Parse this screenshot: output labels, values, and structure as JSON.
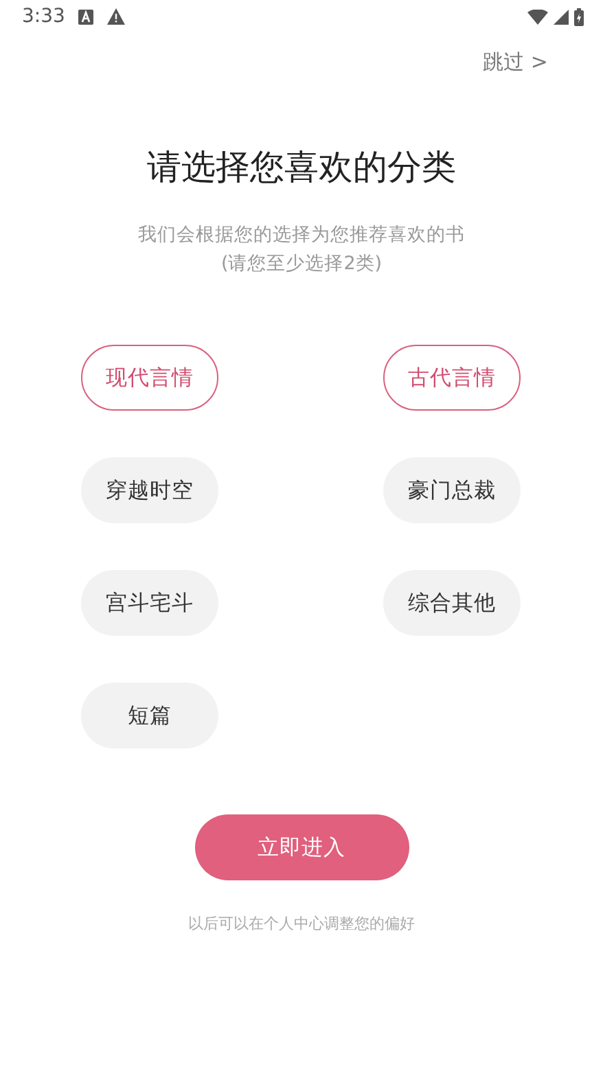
{
  "status_bar": {
    "time": "3:33"
  },
  "skip": "跳过 >",
  "title": "请选择您喜欢的分类",
  "subtitle": [
    "我们会根据您的选择为您推荐喜欢的书",
    "(请您至少选择2类)"
  ],
  "categories": [
    {
      "label": "现代言情",
      "selected": true
    },
    {
      "label": "古代言情",
      "selected": true
    },
    {
      "label": "穿越时空",
      "selected": false
    },
    {
      "label": "豪门总裁",
      "selected": false
    },
    {
      "label": "宫斗宅斗",
      "selected": false
    },
    {
      "label": "综合其他",
      "selected": false
    },
    {
      "label": "短篇",
      "selected": false
    }
  ],
  "enter_button": "立即进入",
  "footer": "以后可以在个人中心调整您的偏好"
}
